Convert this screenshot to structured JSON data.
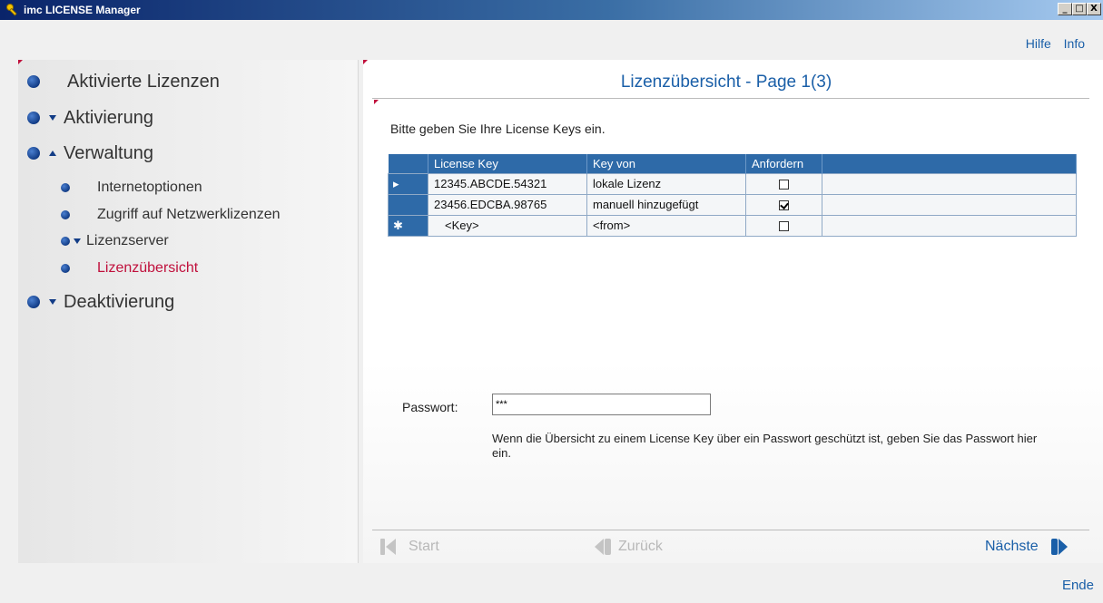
{
  "window": {
    "title": "imc LICENSE Manager",
    "controls": {
      "minimize": "_",
      "maximize": "□",
      "close": "X"
    }
  },
  "toplinks": {
    "help": "Hilfe",
    "info": "Info"
  },
  "sidebar": {
    "items": [
      {
        "label": "Aktivierte Lizenzen",
        "level": 1,
        "arrow": "none"
      },
      {
        "label": "Aktivierung",
        "level": 1,
        "arrow": "down"
      },
      {
        "label": "Verwaltung",
        "level": 1,
        "arrow": "up"
      },
      {
        "label": "Internetoptionen",
        "level": 2,
        "arrow": "none"
      },
      {
        "label": "Zugriff auf Netzwerklizenzen",
        "level": 2,
        "arrow": "none"
      },
      {
        "label": "Lizenzserver",
        "level": 2,
        "arrow": "down"
      },
      {
        "label": "Lizenzübersicht",
        "level": 2,
        "arrow": "none",
        "active": true
      },
      {
        "label": "Deaktivierung",
        "level": 1,
        "arrow": "down"
      }
    ]
  },
  "main": {
    "title": "Lizenzübersicht - Page 1(3)",
    "instruction": "Bitte geben Sie Ihre License Keys ein.",
    "table": {
      "headers": [
        "License Key",
        "Key von",
        "Anfordern",
        ""
      ],
      "rows": [
        {
          "marker": "▸",
          "key": "12345.ABCDE.54321",
          "from": "lokale Lizenz",
          "request": false
        },
        {
          "marker": "",
          "key": "23456.EDCBA.98765",
          "from": "manuell hinzugefügt",
          "request": true
        },
        {
          "marker": "✱",
          "key": "<Key>",
          "from": "<from>",
          "request": false
        }
      ]
    },
    "password": {
      "label": "Passwort:",
      "value": "***",
      "hint": "Wenn die Übersicht zu einem License Key über ein Passwort geschützt ist, geben Sie das Passwort hier ein."
    },
    "navigation": {
      "start": "Start",
      "back": "Zurück",
      "next": "Nächste"
    }
  },
  "footer": {
    "end": "Ende"
  },
  "colors": {
    "accent": "#1a5fa8",
    "active": "#c0103c",
    "table_header": "#2e6aa8"
  }
}
